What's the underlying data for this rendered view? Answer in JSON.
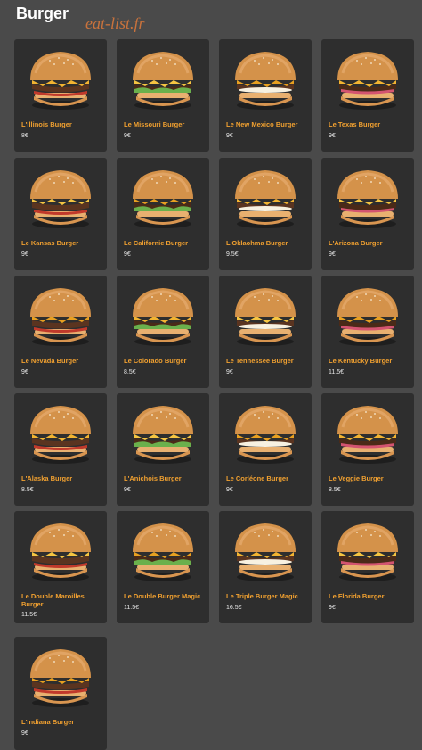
{
  "header": {
    "title": "Burger",
    "watermark": "eat-list.fr"
  },
  "colors": {
    "background": "#4a4a4a",
    "card": "#2e2e2e",
    "item_name": "#f0a030",
    "watermark": "#e07a3a"
  },
  "items": [
    {
      "name": "L'Illinois Burger",
      "price": "8€"
    },
    {
      "name": "Le Missouri Burger",
      "price": "9€"
    },
    {
      "name": "Le New Mexico Burger",
      "price": "9€"
    },
    {
      "name": "Le Texas Burger",
      "price": "9€"
    },
    {
      "name": "Le Kansas Burger",
      "price": "9€"
    },
    {
      "name": "Le Californie Burger",
      "price": "9€"
    },
    {
      "name": "L'Oklaohma Burger",
      "price": "9.5€"
    },
    {
      "name": "L'Arizona Burger",
      "price": "9€"
    },
    {
      "name": "Le Nevada Burger",
      "price": "9€"
    },
    {
      "name": "Le Colorado Burger",
      "price": "8.5€"
    },
    {
      "name": "Le Tennessee Burger",
      "price": "9€"
    },
    {
      "name": "Le Kentucky Burger",
      "price": "11.5€"
    },
    {
      "name": "L'Alaska Burger",
      "price": "8.5€"
    },
    {
      "name": "L'Anichois Burger",
      "price": "9€"
    },
    {
      "name": "Le Corléone Burger",
      "price": "9€"
    },
    {
      "name": "Le Veggie Burger",
      "price": "8.5€"
    },
    {
      "name": "Le Double Maroilles Burger",
      "price": "11.5€"
    },
    {
      "name": "Le Double Burger Magic",
      "price": "11.5€"
    },
    {
      "name": "Le Triple Burger Magic",
      "price": "16.5€"
    },
    {
      "name": "Le Florida Burger",
      "price": "9€"
    },
    {
      "name": "L'Indiana Burger",
      "price": "9€"
    }
  ]
}
